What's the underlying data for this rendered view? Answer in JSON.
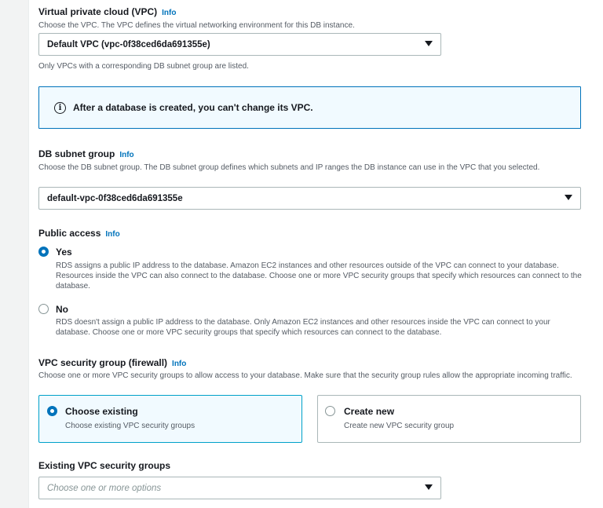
{
  "vpc": {
    "label": "Virtual private cloud (VPC)",
    "info": "Info",
    "description": "Choose the VPC. The VPC defines the virtual networking environment for this DB instance.",
    "selected": "Default VPC (vpc-0f38ced6da691355e)",
    "hint": "Only VPCs with a corresponding DB subnet group are listed."
  },
  "alert": {
    "icon": "info-circle-icon",
    "text": "After a database is created, you can't change its VPC."
  },
  "subnet": {
    "label": "DB subnet group",
    "info": "Info",
    "description": "Choose the DB subnet group. The DB subnet group defines which subnets and IP ranges the DB instance can use in the VPC that you selected.",
    "selected": "default-vpc-0f38ced6da691355e"
  },
  "public_access": {
    "label": "Public access",
    "info": "Info",
    "options": [
      {
        "label": "Yes",
        "checked": true,
        "description": "RDS assigns a public IP address to the database. Amazon EC2 instances and other resources outside of the VPC can connect to your database. Resources inside the VPC can also connect to the database. Choose one or more VPC security groups that specify which resources can connect to the database."
      },
      {
        "label": "No",
        "checked": false,
        "description": "RDS doesn't assign a public IP address to the database. Only Amazon EC2 instances and other resources inside the VPC can connect to your database. Choose one or more VPC security groups that specify which resources can connect to the database."
      }
    ]
  },
  "security_group": {
    "label": "VPC security group (firewall)",
    "info": "Info",
    "description": "Choose one or more VPC security groups to allow access to your database. Make sure that the security group rules allow the appropriate incoming traffic.",
    "tiles": [
      {
        "label": "Choose existing",
        "description": "Choose existing VPC security groups",
        "checked": true
      },
      {
        "label": "Create new",
        "description": "Create new VPC security group",
        "checked": false
      }
    ]
  },
  "existing_groups": {
    "label": "Existing VPC security groups",
    "placeholder": "Choose one or more options"
  },
  "colors": {
    "accent": "#0073bb",
    "tile_border": "#00a1c9",
    "info_bg": "#f1faff"
  }
}
